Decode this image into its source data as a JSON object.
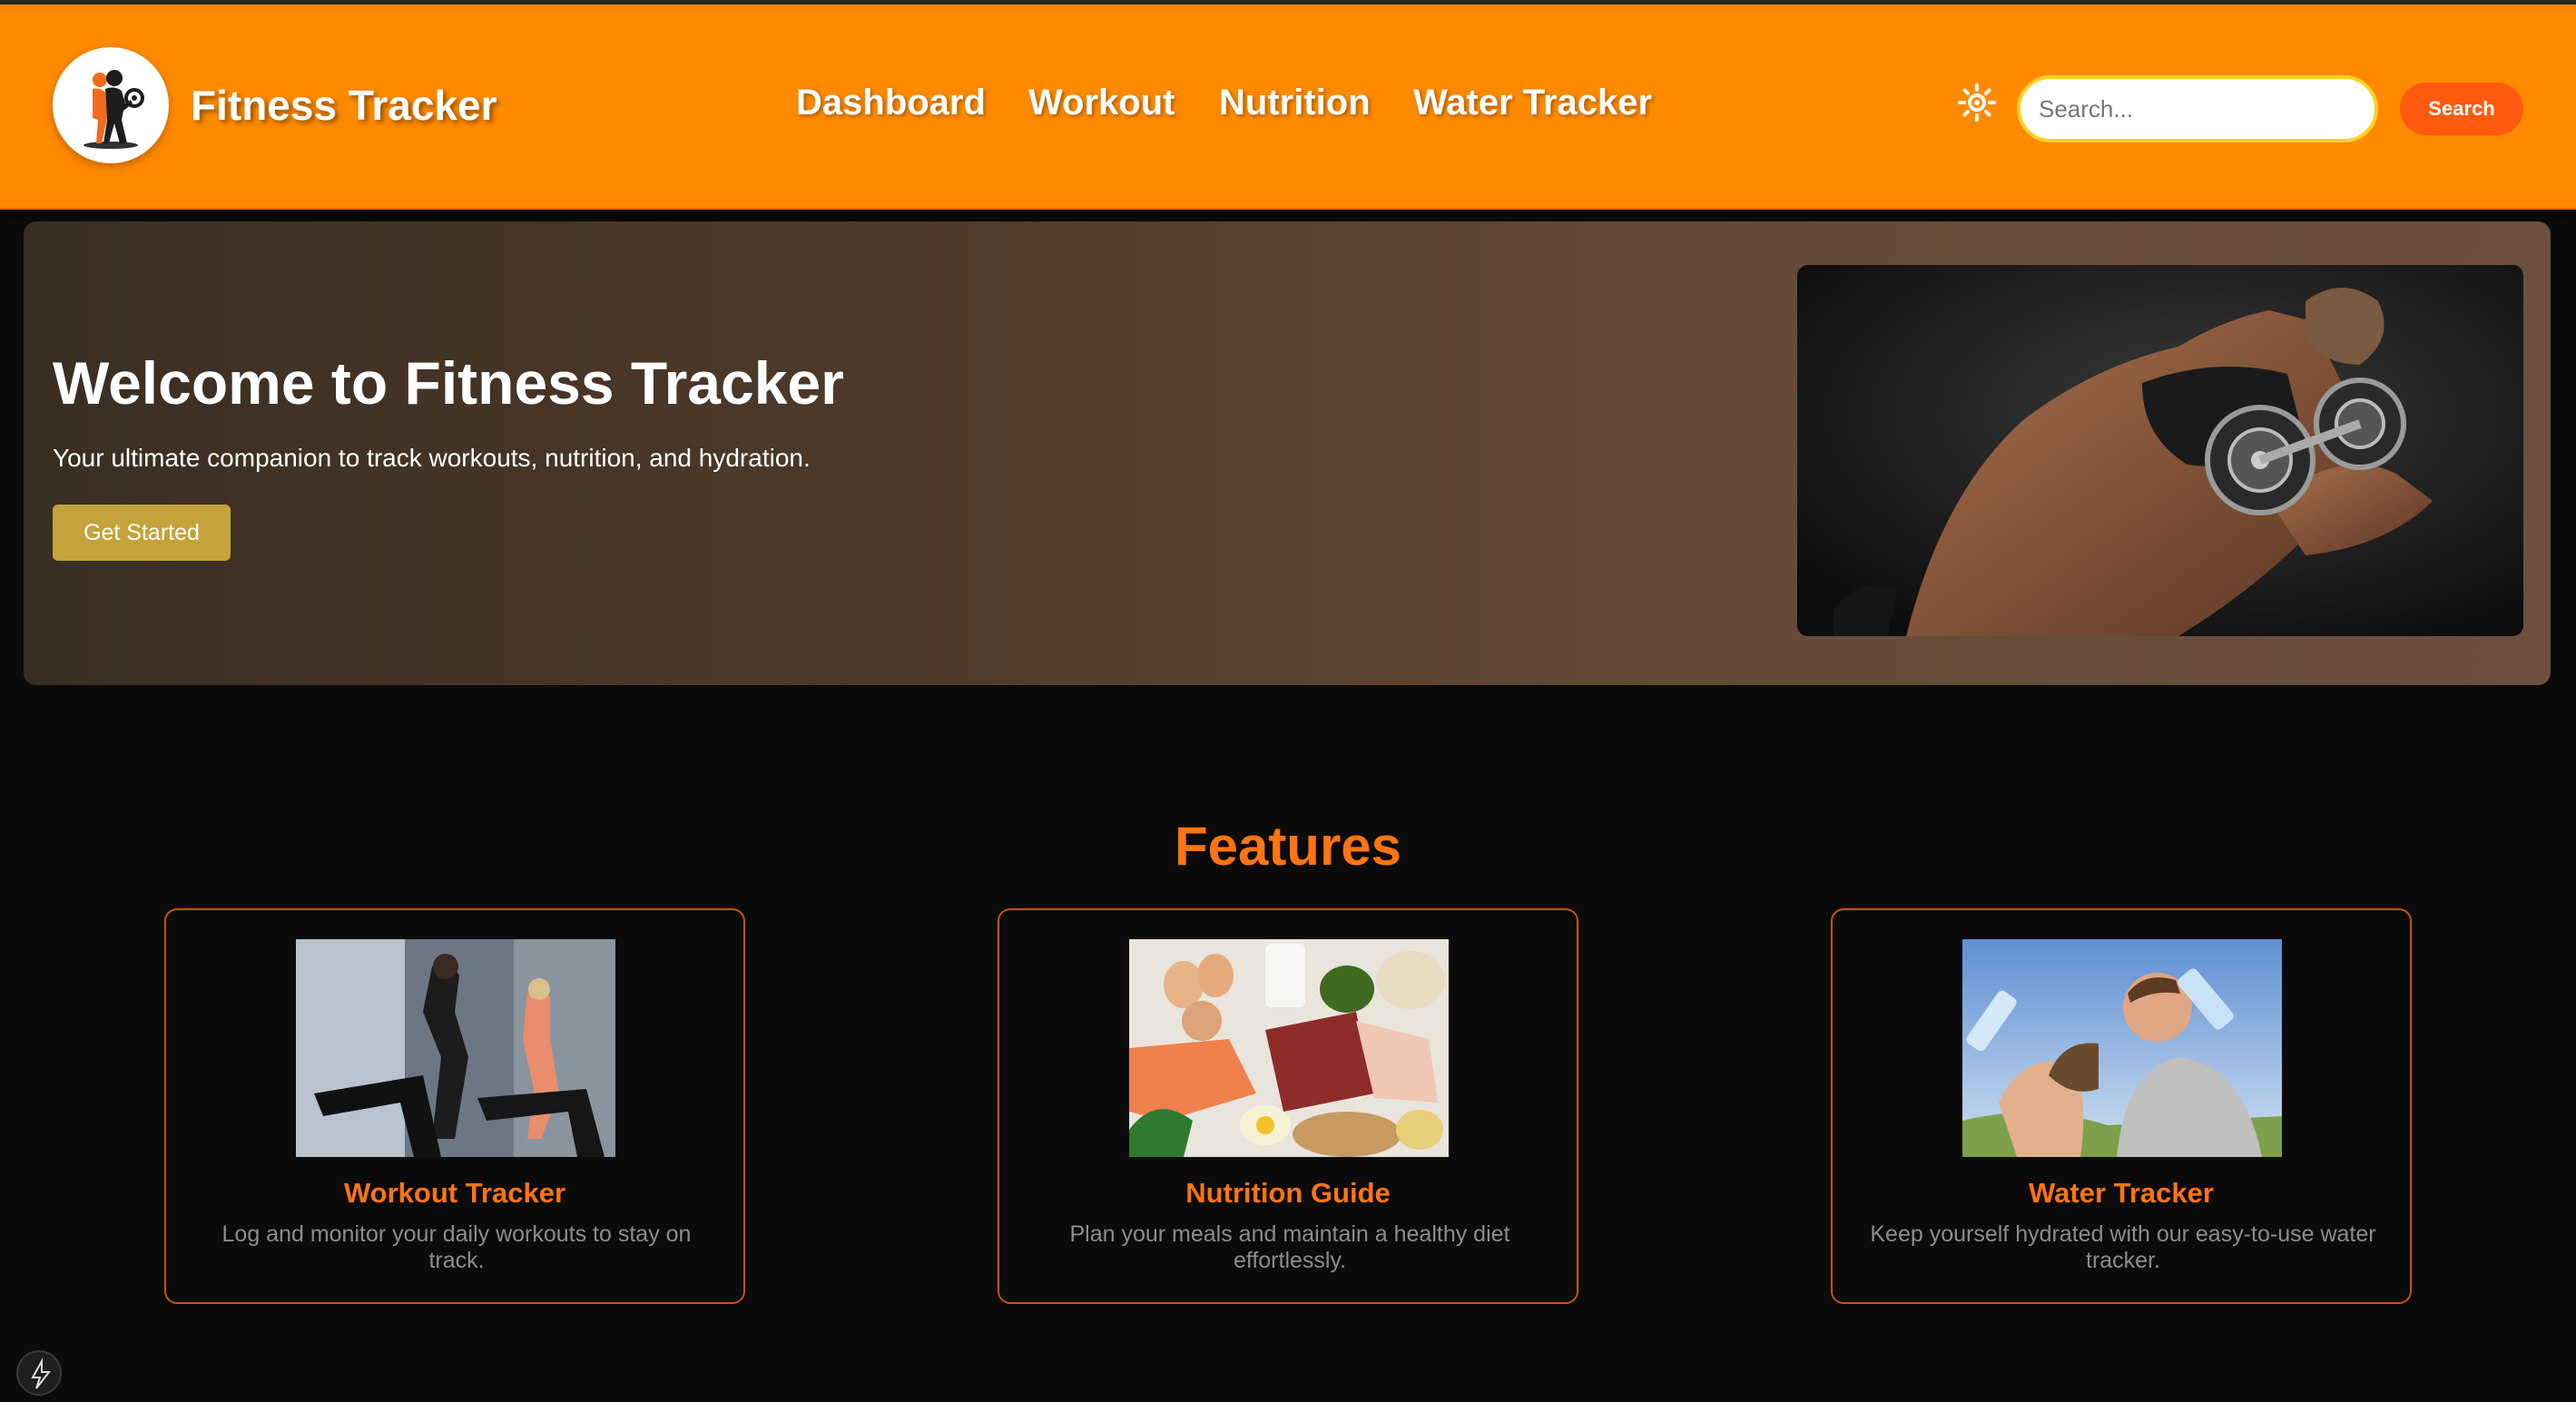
{
  "app": {
    "title": "Fitness Tracker",
    "logo_icon": "fitness-person-dumbbell-icon"
  },
  "colors": {
    "header_bg": "#ff8a00",
    "accent": "#ff7412",
    "search_button_bg": "#ff5a0f",
    "cta_bg": "#c3a33a",
    "page_bg": "#0b0b0b"
  },
  "nav": {
    "items": [
      {
        "label": "Dashboard"
      },
      {
        "label": "Workout"
      },
      {
        "label": "Nutrition"
      },
      {
        "label": "Water Tracker"
      }
    ]
  },
  "header": {
    "theme_toggle_icon": "sun-icon",
    "search": {
      "placeholder": "Search...",
      "value": "",
      "button_label": "Search"
    }
  },
  "hero": {
    "title": "Welcome to Fitness Tracker",
    "subtitle": "Your ultimate companion to track workouts, nutrition, and hydration.",
    "cta_label": "Get Started",
    "image_subject": "woman-lifting-dumbbell"
  },
  "features": {
    "heading": "Features",
    "cards": [
      {
        "title": "Workout Tracker",
        "description": "Log and monitor your daily workouts to stay on track.",
        "image_subject": "treadmill-runners"
      },
      {
        "title": "Nutrition Guide",
        "description": "Plan your meals and maintain a healthy diet effortlessly.",
        "image_subject": "protein-foods"
      },
      {
        "title": "Water Tracker",
        "description": "Keep yourself hydrated with our easy-to-use water tracker.",
        "image_subject": "people-drinking-water"
      }
    ]
  }
}
